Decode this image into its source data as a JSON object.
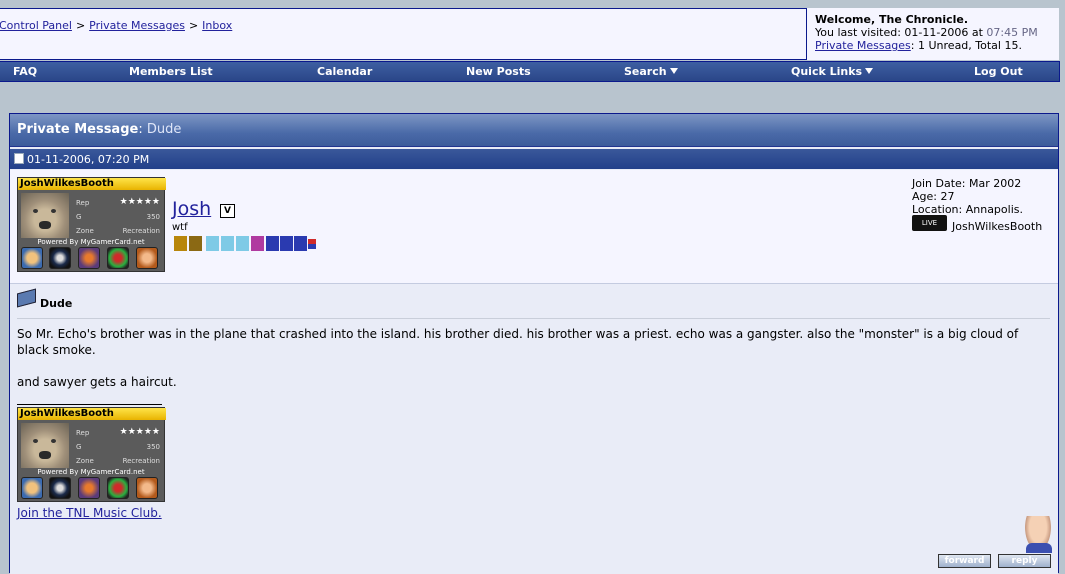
{
  "breadcrumb": {
    "items": [
      "Control Panel",
      "Private Messages",
      "Inbox"
    ],
    "separator": ">"
  },
  "welcome": {
    "greeting": "Welcome, The Chronicle.",
    "last_visited_label": "You last visited: 01-11-2006 at",
    "last_visited_time": "07:45 PM",
    "pm_link": "Private Messages",
    "pm_status": "1 Unread, Total 15."
  },
  "navbar": {
    "items": [
      {
        "label": "FAQ"
      },
      {
        "label": "Members List"
      },
      {
        "label": "Calendar"
      },
      {
        "label": "New Posts"
      },
      {
        "label": "Search"
      },
      {
        "label": "Quick Links"
      },
      {
        "label": "Log Out"
      }
    ]
  },
  "pm": {
    "header_label": "Private Message",
    "subject": "Dude",
    "date": "01-11-2006, 07:20 PM"
  },
  "user": {
    "name": "Josh",
    "title": "wtf",
    "badge": "V",
    "stats": {
      "join_date": "Join Date: Mar 2002",
      "age": "Age: 27",
      "location": "Location: Annapolis."
    },
    "xbox_logo_text": "LIVE",
    "gamertag": "JoshWilkesBooth"
  },
  "gamercard": {
    "gamertag": "JoshWilkesBooth",
    "rep_label": "Rep",
    "rep_value": "★★★★★",
    "score_label": "G",
    "score_value": "350",
    "zone_label": "Zone",
    "zone_value": "Recreation",
    "powered": "Powered By MyGamerCard.net"
  },
  "message": {
    "title": "Dude",
    "paragraphs": [
      "So Mr. Echo's brother was in the plane that crashed into the island. his brother died. his brother was a priest. echo was a gangster. also the \"monster\" is a big cloud of black smoke.",
      "and sawyer gets a haircut."
    ],
    "signature_link": "Join the TNL Music Club."
  },
  "buttons": {
    "forward": "forward",
    "reply": "reply"
  },
  "colors": {
    "navbar": "#2a4688",
    "panel_bg": "#e9ecf7",
    "link": "#22229c",
    "gamertag_gold": "#ffe54a"
  }
}
